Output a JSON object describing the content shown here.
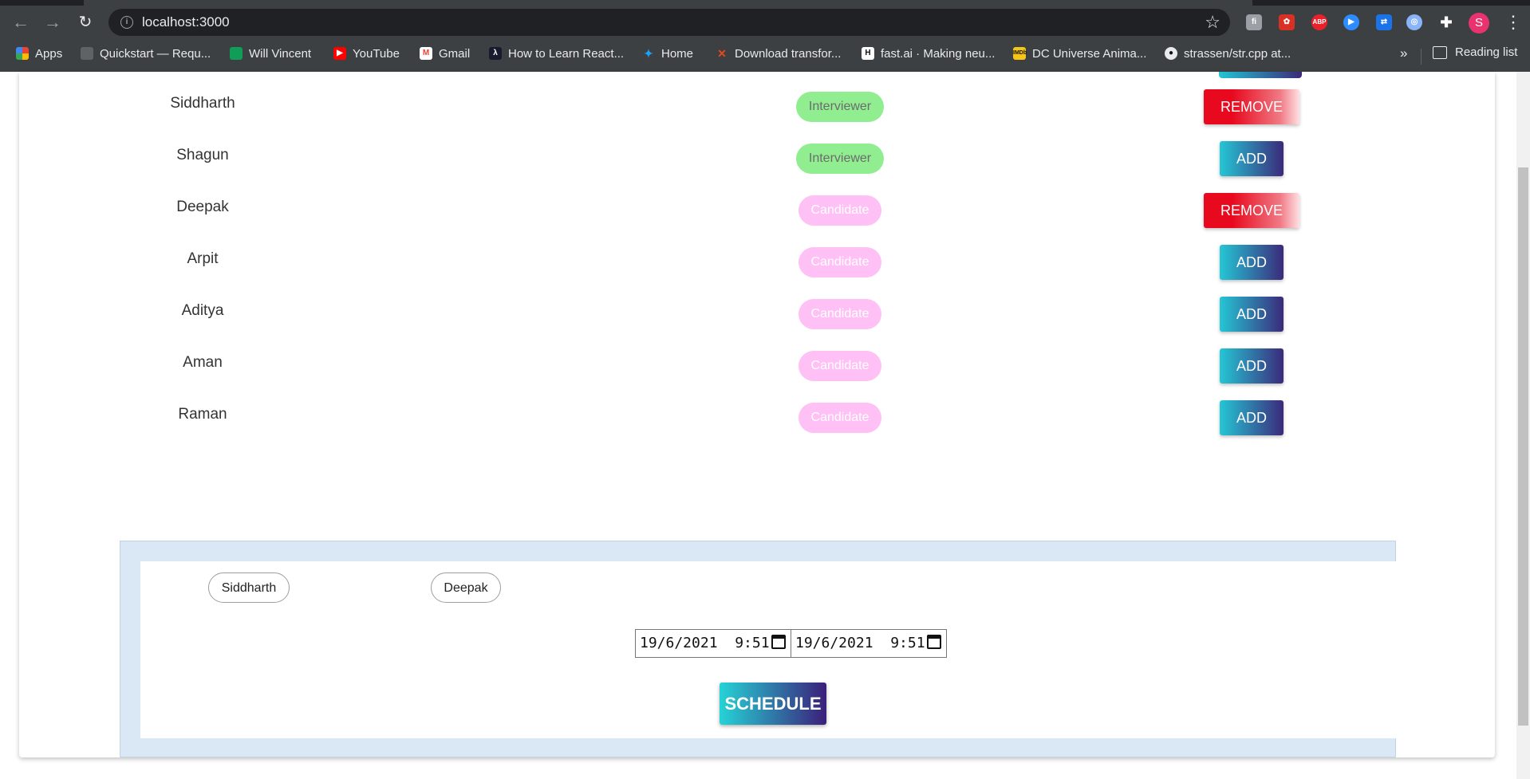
{
  "browser": {
    "url": "localhost:3000",
    "avatar_letter": "S",
    "bookmarks": [
      {
        "label": "Apps",
        "color": "#ea4335"
      },
      {
        "label": "Quickstart — Requ...",
        "color": "#9aa0a6"
      },
      {
        "label": "Will Vincent",
        "color": "#0f9d58"
      },
      {
        "label": "YouTube",
        "color": "#ff0000"
      },
      {
        "label": "Gmail",
        "color": "#4285f4"
      },
      {
        "label": "How to Learn React...",
        "color": "#000000"
      },
      {
        "label": "Home",
        "color": "#1da1f2"
      },
      {
        "label": "Download transfor...",
        "color": "#e8461e"
      },
      {
        "label": "fast.ai · Making neu...",
        "color": "#111111"
      },
      {
        "label": "DC Universe Anima...",
        "color": "#f5c518"
      },
      {
        "label": "strassen/str.cpp at...",
        "color": "#111111"
      }
    ],
    "overflow": "»",
    "reading_list": "Reading list"
  },
  "participants": [
    {
      "name": "Siddharth",
      "role": "Interviewer",
      "action": "REMOVE"
    },
    {
      "name": "Shagun",
      "role": "Interviewer",
      "action": "ADD"
    },
    {
      "name": "Deepak",
      "role": "Candidate",
      "action": "REMOVE"
    },
    {
      "name": "Arpit",
      "role": "Candidate",
      "action": "ADD"
    },
    {
      "name": "Aditya",
      "role": "Candidate",
      "action": "ADD"
    },
    {
      "name": "Aman",
      "role": "Candidate",
      "action": "ADD"
    },
    {
      "name": "Raman",
      "role": "Candidate",
      "action": "ADD"
    }
  ],
  "schedule": {
    "selected": [
      "Siddharth",
      "Deepak"
    ],
    "start_datetime": "19/6/2021  9:51",
    "end_datetime": "19/6/2021  9:51",
    "button_label": "SCHEDULE"
  },
  "colors": {
    "interviewer_badge": "#90ee90",
    "candidate_badge": "#ffc0f5",
    "remove_button": "#e8091e",
    "add_gradient_start": "#25c6d6",
    "add_gradient_end": "#3b2a7a",
    "schedule_panel_bg": "#dae8f6"
  }
}
